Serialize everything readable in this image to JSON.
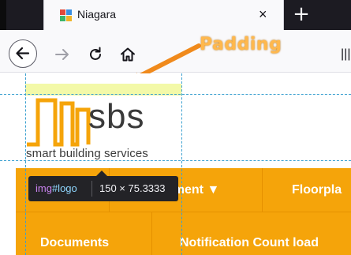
{
  "browser": {
    "tab_title": "Niagara",
    "tab_close_glyph": "×",
    "new_tab_glyph": "+",
    "menu_glyph": "|||"
  },
  "annotation": {
    "label": "Padding",
    "color": "#ffb84d"
  },
  "logo": {
    "wordmark": "sbs",
    "tagline": "smart building services",
    "brand_color": "#f5a40a"
  },
  "inspector_tooltip": {
    "tag": "img",
    "id": "#logo",
    "dimensions": "150 × 75.3333"
  },
  "menu": {
    "row1": [
      "pment ▼",
      "Floorpla"
    ],
    "row2": [
      "Documents",
      "Notification Count load"
    ]
  },
  "colors": {
    "accent_orange": "#f5a40a",
    "guide_line": "#3aa0d0",
    "padding_highlight": "#f3f9a8"
  }
}
